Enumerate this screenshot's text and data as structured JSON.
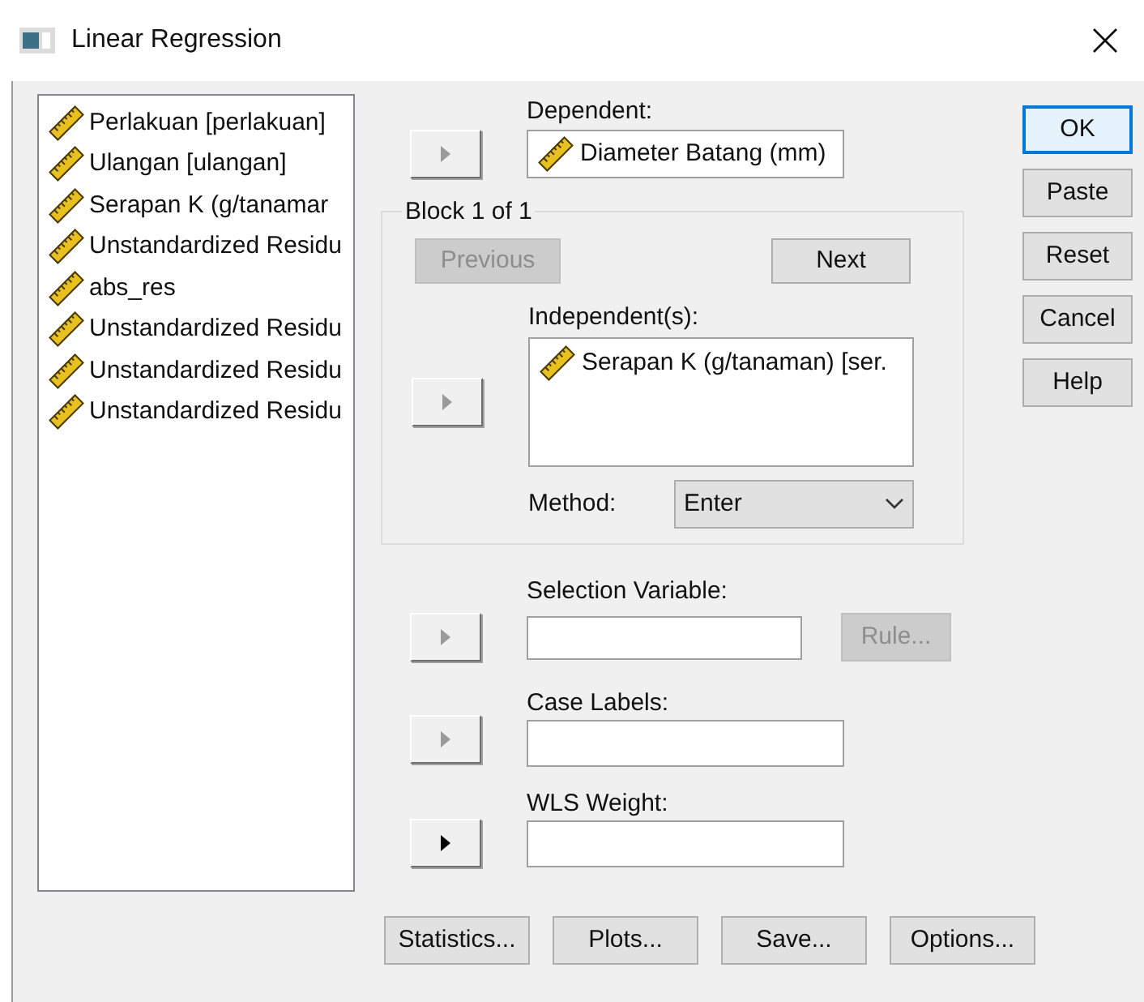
{
  "window": {
    "title": "Linear Regression"
  },
  "variables": [
    {
      "label": "Perlakuan [perlakuan]"
    },
    {
      "label": "Ulangan [ulangan]"
    },
    {
      "label": "Serapan K (g/tanamar"
    },
    {
      "label": "Unstandardized Residu"
    },
    {
      "label": "abs_res"
    },
    {
      "label": "Unstandardized Residu"
    },
    {
      "label": "Unstandardized Residu"
    },
    {
      "label": "Unstandardized Residu"
    }
  ],
  "dependent": {
    "label": "Dependent:",
    "value": "Diameter Batang (mm)",
    "move_disabled": true
  },
  "block": {
    "legend": "Block 1 of 1",
    "previous": {
      "label": "Previous",
      "disabled": true
    },
    "next": {
      "label": "Next",
      "disabled": false
    },
    "independent": {
      "label": "Independent(s):",
      "items": [
        "Serapan K (g/tanaman) [ser."
      ],
      "move_disabled": true
    },
    "method": {
      "label": "Method:",
      "value": "Enter"
    }
  },
  "selection_variable": {
    "label": "Selection Variable:",
    "move_disabled": true,
    "rule": {
      "label": "Rule...",
      "disabled": true
    }
  },
  "case_labels": {
    "label": "Case Labels:",
    "move_disabled": true
  },
  "wls_weight": {
    "label": "WLS Weight:",
    "move_disabled": false
  },
  "side_buttons": [
    {
      "label": "OK",
      "default": true
    },
    {
      "label": "Paste",
      "default": false
    },
    {
      "label": "Reset",
      "default": false
    },
    {
      "label": "Cancel",
      "default": false
    },
    {
      "label": "Help",
      "default": false
    }
  ],
  "bottom_buttons": [
    "Statistics...",
    "Plots...",
    "Save...",
    "Options..."
  ]
}
